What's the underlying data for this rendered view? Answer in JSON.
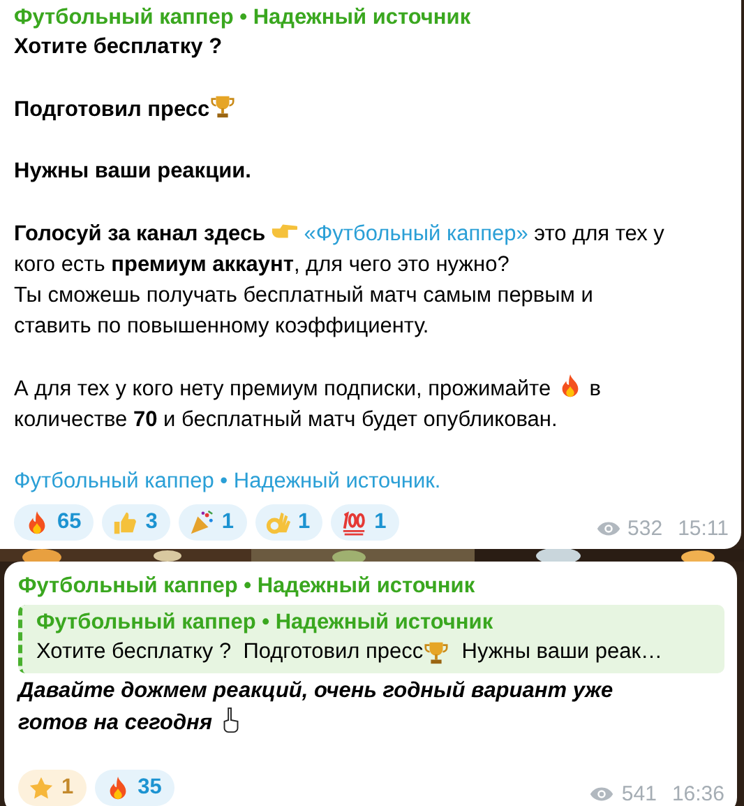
{
  "messages": [
    {
      "author": "Футбольный каппер • Надежный источник",
      "paragraphs": [
        {
          "bold": true,
          "italic": false,
          "parts": [
            {
              "kind": "text",
              "text": "Хотите бесплатку ?"
            }
          ]
        },
        {
          "bold": true,
          "italic": false,
          "parts": [
            {
              "kind": "text",
              "text": "Подготовил пресс"
            },
            {
              "kind": "trophy"
            }
          ]
        },
        {
          "bold": true,
          "italic": false,
          "parts": [
            {
              "kind": "text",
              "text": "Нужны ваши реакции."
            }
          ]
        },
        {
          "bold": false,
          "italic": false,
          "parts": [
            {
              "kind": "text",
              "text": "**Голосуй за канал здесь** "
            },
            {
              "kind": "pointing-hand"
            },
            {
              "kind": "link",
              "text": " «Футбольный каппер»"
            },
            {
              "kind": "text",
              "text": " это для тех у кого есть **премиум аккаунт**, для чего это нужно?\nТы сможешь получать бесплатный матч самым первым и ставить по повышенному коэффициенту."
            }
          ]
        },
        {
          "bold": false,
          "italic": false,
          "parts": [
            {
              "kind": "text",
              "text": "А для тех у кого нету премиум подписки, прожимайте "
            },
            {
              "kind": "fire"
            },
            {
              "kind": "text",
              "text": " в количестве **70** и бесплатный матч будет опубликован."
            }
          ]
        }
      ],
      "footer_link": "Футбольный каппер • Надежный источник.",
      "reactions": [
        {
          "kind": "fire",
          "count": "65",
          "paid": false
        },
        {
          "kind": "thumbs-up",
          "count": "3",
          "paid": false
        },
        {
          "kind": "party",
          "count": "1",
          "paid": false
        },
        {
          "kind": "ok-hand",
          "count": "1",
          "paid": false
        },
        {
          "kind": "hundred",
          "count": "1",
          "paid": false
        }
      ],
      "views": "532",
      "time": "15:11"
    },
    {
      "author": "Футбольный каппер • Надежный источник",
      "quote": {
        "title": "Футбольный каппер • Надежный источник",
        "parts": [
          {
            "kind": "text",
            "text": "Хотите бесплатку ?  Подготовил пресс"
          },
          {
            "kind": "trophy"
          },
          {
            "kind": "text",
            "text": "  Нужны ваши реак…"
          }
        ]
      },
      "paragraphs": [
        {
          "bold": true,
          "italic": true,
          "parts": [
            {
              "kind": "text",
              "text": "Давайте дожмем реакций, очень годный вариант уже готов на сегодня "
            },
            {
              "kind": "raised-finger"
            }
          ]
        }
      ],
      "reactions": [
        {
          "kind": "star",
          "count": "1",
          "paid": true
        },
        {
          "kind": "fire",
          "count": "35",
          "paid": false
        }
      ],
      "views": "541",
      "time": "16:36"
    }
  ]
}
